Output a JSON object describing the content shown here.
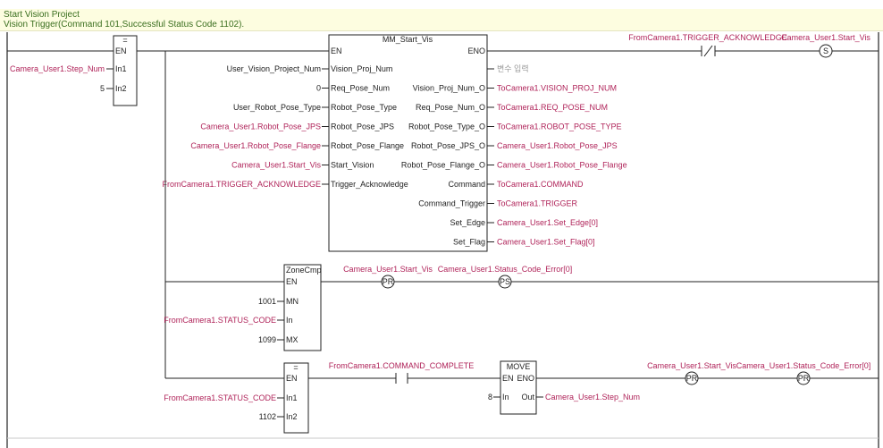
{
  "comment": {
    "line1": "Start Vision Project",
    "line2": "Vision Trigger(Command 101,Successful Status Code 1102)."
  },
  "rung1": {
    "eq_block": {
      "title": "=",
      "en": "EN",
      "in1": "In1",
      "in2": "In2",
      "in1_var": "Camera_User1.Step_Num",
      "in2_var": "5"
    },
    "fb": {
      "title": "MM_Start_Vis",
      "en": "EN",
      "eno": "ENO",
      "inputs": [
        {
          "pin": "Vision_Proj_Num",
          "var": "User_Vision_Project_Num",
          "color": "black"
        },
        {
          "pin": "Req_Pose_Num",
          "var": "0",
          "color": "black"
        },
        {
          "pin": "Robot_Pose_Type",
          "var": "User_Robot_Pose_Type",
          "color": "black"
        },
        {
          "pin": "Robot_Pose_JPS",
          "var": "Camera_User1.Robot_Pose_JPS",
          "color": "red"
        },
        {
          "pin": "Robot_Pose_Flange",
          "var": "Camera_User1.Robot_Pose_Flange",
          "color": "red"
        },
        {
          "pin": "Start_Vision",
          "var": "Camera_User1.Start_Vis",
          "color": "red"
        },
        {
          "pin": "Trigger_Acknowledge",
          "var": "FromCamera1.TRIGGER_ACKNOWLEDGE",
          "color": "red"
        }
      ],
      "outputs": [
        {
          "pin": "",
          "var": "변수 입력",
          "color": "gray"
        },
        {
          "pin": "Vision_Proj_Num_O",
          "var": "ToCamera1.VISION_PROJ_NUM",
          "color": "red"
        },
        {
          "pin": "Req_Pose_Num_O",
          "var": "ToCamera1.REQ_POSE_NUM",
          "color": "red"
        },
        {
          "pin": "Robot_Pose_Type_O",
          "var": "ToCamera1.ROBOT_POSE_TYPE",
          "color": "red"
        },
        {
          "pin": "Robot_Pose_JPS_O",
          "var": "Camera_User1.Robot_Pose_JPS",
          "color": "red"
        },
        {
          "pin": "Robot_Pose_Flange_O",
          "var": "Camera_User1.Robot_Pose_Flange",
          "color": "red"
        },
        {
          "pin": "Command",
          "var": "ToCamera1.COMMAND",
          "color": "red"
        },
        {
          "pin": "Command_Trigger",
          "var": "ToCamera1.TRIGGER",
          "color": "red"
        },
        {
          "pin": "Set_Edge",
          "var": "Camera_User1.Set_Edge[0]",
          "color": "red"
        },
        {
          "pin": "Set_Flag",
          "var": "Camera_User1.Set_Flag[0]",
          "color": "red"
        }
      ]
    },
    "contact_var": "FromCamera1.TRIGGER_ACKNOWLEDGE",
    "coil_var": "Camera_User1.Start_Vis",
    "coil_type": "S"
  },
  "rung2": {
    "zone": {
      "title": "ZoneCmp",
      "en": "EN",
      "mn": "MN",
      "in": "In",
      "mx": "MX",
      "mn_var": "1001",
      "in_var": "FromCamera1.STATUS_CODE",
      "mx_var": "1099"
    },
    "coil1_var": "Camera_User1.Start_Vis",
    "coil1_type": "PR",
    "coil2_var": "Camera_User1.Status_Code_Error[0]",
    "coil2_type": "PS"
  },
  "rung3": {
    "eq_block": {
      "title": "=",
      "en": "EN",
      "in1": "In1",
      "in2": "In2",
      "in1_var": "FromCamera1.STATUS_CODE",
      "in2_var": "1102"
    },
    "contact_var": "FromCamera1.COMMAND_COMPLETE",
    "move": {
      "title": "MOVE",
      "en": "EN",
      "eno": "ENO",
      "in": "In",
      "out": "Out",
      "in_var": "8",
      "out_var": "Camera_User1.Step_Num"
    },
    "coil1_var": "Camera_User1.Start_Vis",
    "coil1_type": "PR",
    "coil2_var": "Camera_User1.Status_Code_Error[0]",
    "coil2_type": "PR"
  }
}
